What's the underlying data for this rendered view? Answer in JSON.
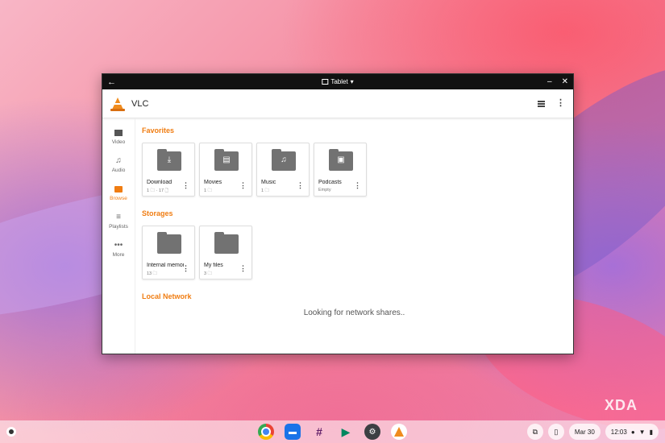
{
  "window": {
    "mode_label": "Tablet",
    "back_glyph": "←",
    "minimize_glyph": "–",
    "close_glyph": "✕"
  },
  "app": {
    "title": "VLC"
  },
  "sidebar": {
    "items": [
      {
        "label": "Video",
        "icon": "video-icon"
      },
      {
        "label": "Audio",
        "icon": "music-note-icon"
      },
      {
        "label": "Browse",
        "icon": "folder-icon",
        "active": true
      },
      {
        "label": "Playlists",
        "icon": "playlist-icon"
      },
      {
        "label": "More",
        "icon": "more-horiz-icon"
      }
    ]
  },
  "favorites": {
    "title": "Favorites",
    "items": [
      {
        "name": "Download",
        "meta": "1 🗀 · 17 🗋",
        "icon": "download-folder-icon"
      },
      {
        "name": "Movies",
        "meta": "1 🗀",
        "icon": "movies-folder-icon"
      },
      {
        "name": "Music",
        "meta": "1 🗀",
        "icon": "music-folder-icon"
      },
      {
        "name": "Podcasts",
        "meta": "Empty",
        "icon": "podcasts-folder-icon"
      }
    ]
  },
  "storages": {
    "title": "Storages",
    "items": [
      {
        "name": "Internal memory",
        "meta": "13 🗀",
        "icon": "folder-icon"
      },
      {
        "name": "My files",
        "meta": "3 🗀",
        "icon": "folder-icon"
      }
    ]
  },
  "network": {
    "title": "Local Network",
    "status": "Looking for network shares.."
  },
  "shelf": {
    "date": "Mar 30",
    "time": "12:03"
  },
  "watermark": "XDA",
  "colors": {
    "accent": "#f07d12",
    "folder": "#727272",
    "titlebar": "#111111"
  }
}
